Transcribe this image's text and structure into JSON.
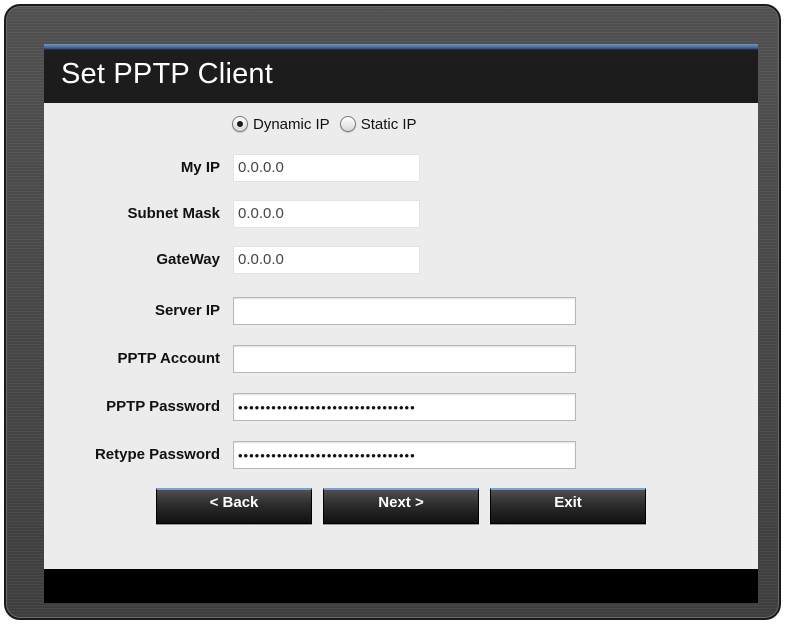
{
  "title": "Set PPTP Client",
  "ip_mode": {
    "options": [
      {
        "label": "Dynamic IP",
        "selected": true
      },
      {
        "label": "Static IP",
        "selected": false
      }
    ]
  },
  "fields": {
    "my_ip": {
      "label": "My IP",
      "value": "0.0.0.0"
    },
    "subnet_mask": {
      "label": "Subnet Mask",
      "value": "0.0.0.0"
    },
    "gateway": {
      "label": "GateWay",
      "value": "0.0.0.0"
    },
    "server_ip": {
      "label": "Server IP",
      "value": ""
    },
    "pptp_account": {
      "label": "PPTP Account",
      "value": ""
    },
    "pptp_password": {
      "label": "PPTP Password",
      "masked": "••••••••••••••••••••••••••••••••"
    },
    "retype_password": {
      "label": "Retype Password",
      "masked": "••••••••••••••••••••••••••••••••"
    }
  },
  "buttons": {
    "back": "< Back",
    "next": "Next >",
    "exit": "Exit"
  },
  "colors": {
    "panel_bg": "#ececec",
    "title_bar": "#1b1b1b",
    "accent_blue": "#6f95c8",
    "frame": "#4a4a4a"
  }
}
